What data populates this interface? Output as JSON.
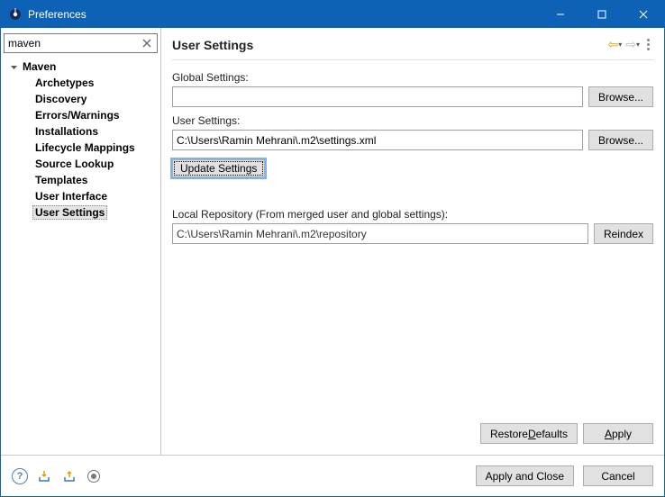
{
  "window": {
    "title": "Preferences"
  },
  "search": {
    "value": "maven",
    "placeholder": ""
  },
  "tree": {
    "root": {
      "label": "Maven",
      "expanded": true
    },
    "items": [
      {
        "label": "Archetypes",
        "selected": false
      },
      {
        "label": "Discovery",
        "selected": false
      },
      {
        "label": "Errors/Warnings",
        "selected": false
      },
      {
        "label": "Installations",
        "selected": false
      },
      {
        "label": "Lifecycle Mappings",
        "selected": false
      },
      {
        "label": "Source Lookup",
        "selected": false
      },
      {
        "label": "Templates",
        "selected": false
      },
      {
        "label": "User Interface",
        "selected": false
      },
      {
        "label": "User Settings",
        "selected": true
      }
    ]
  },
  "page": {
    "title": "User Settings",
    "globalSettingsLabel": "Global Settings:",
    "globalSettingsValue": "",
    "browseLabel": "Browse...",
    "userSettingsLabel": "User Settings:",
    "userSettingsValue": "C:\\Users\\Ramin Mehrani\\.m2\\settings.xml",
    "updateSettingsLabel": "Update Settings",
    "localRepoLabel": "Local Repository (From merged user and global settings):",
    "localRepoValue": "C:\\Users\\Ramin Mehrani\\.m2\\repository",
    "reindexLabel": "Reindex",
    "restoreDefaults_pre": "Restore ",
    "restoreDefaults_u": "D",
    "restoreDefaults_post": "efaults",
    "apply_u": "A",
    "apply_post": "pply"
  },
  "footer": {
    "applyClose": "Apply and Close",
    "cancel": "Cancel"
  }
}
